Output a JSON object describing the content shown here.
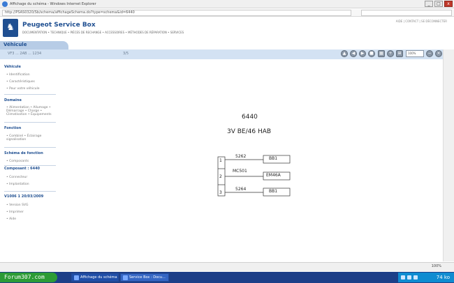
{
  "window": {
    "title": "Affichage du schéma - Windows Internet Explorer",
    "url": "http://PSAS0320/Sb/schema/affichageSchema.do?type=schema&id=6440",
    "controls": {
      "minimize": "_",
      "maximize": "□",
      "close": "x"
    }
  },
  "site": {
    "brand": "Peugeot Service Box",
    "nav": "DOCUMENTATION • TECHNIQUE • PIÈCES DE RECHANGE • ACCESSOIRES • MÉTHODES DE RÉPARATION • SERVICES",
    "header_right": "AIDE | CONTACT | SE DÉCONNECTER"
  },
  "vehicle": {
    "tab_label": "Véhicule",
    "vin": "VF3 ... 2AB ... 1234",
    "middle": "3/5"
  },
  "toolbar": {
    "buttons": [
      "▲",
      "◀",
      "▶",
      "■",
      "▦",
      "+",
      "⊞"
    ],
    "zoom_value": "100%",
    "zoom_out": "−",
    "zoom_close": "×"
  },
  "sidebar": {
    "sections": [
      {
        "title": "Véhicule",
        "items": [
          "Identification",
          "Caractéristiques",
          "Pour votre véhicule"
        ]
      },
      {
        "title": "Domaine",
        "items": [
          "Alimentation • Allumage • Démarrage • Charge • Climatisation • Équipements"
        ]
      },
      {
        "title": "Fonction",
        "items": [
          "Combiné • Éclairage signalisation"
        ]
      },
      {
        "title": "Schéma de fonction",
        "items": [
          "Composants"
        ]
      },
      {
        "title": "Composant : 6440",
        "items": [
          "Connecteur",
          "Implantation"
        ]
      },
      {
        "title": "V1006 1 20/03/2009",
        "items": [
          "Version SVG",
          "Imprimer",
          "Aide"
        ]
      }
    ]
  },
  "diagram": {
    "component_id": "6440",
    "connector_desc": "3V BE/46 HAB",
    "pins": [
      "1",
      "2",
      "3"
    ],
    "wires": [
      "5262",
      "MC501",
      "5264"
    ],
    "connectors": [
      "BB1",
      "EM46A",
      "BB1"
    ]
  },
  "status": {
    "zoom": "100%"
  },
  "taskbar": {
    "start_label": "Forum307.com",
    "tasks": [
      "Affichage du schéma",
      "Service Box : Docu..."
    ],
    "tray_text": "74 ko"
  }
}
